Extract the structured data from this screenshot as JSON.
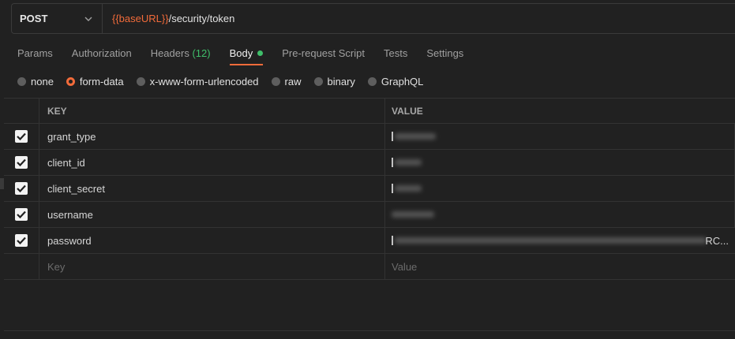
{
  "request": {
    "method": "POST",
    "url_variable": "{{baseURL}}",
    "url_path": "/security/token"
  },
  "tabs": [
    {
      "label": "Params"
    },
    {
      "label": "Authorization"
    },
    {
      "label": "Headers",
      "count": "(12)"
    },
    {
      "label": "Body",
      "active": true
    },
    {
      "label": "Pre-request Script"
    },
    {
      "label": "Tests"
    },
    {
      "label": "Settings"
    }
  ],
  "body_types": [
    {
      "label": "none",
      "selected": false
    },
    {
      "label": "form-data",
      "selected": true
    },
    {
      "label": "x-www-form-urlencoded",
      "selected": false
    },
    {
      "label": "raw",
      "selected": false
    },
    {
      "label": "binary",
      "selected": false
    },
    {
      "label": "GraphQL",
      "selected": false
    }
  ],
  "table": {
    "headers": {
      "key": "KEY",
      "value": "VALUE"
    },
    "rows": [
      {
        "key": "grant_type",
        "checked": true,
        "value_truncated": ""
      },
      {
        "key": "client_id",
        "checked": true,
        "value_truncated": ""
      },
      {
        "key": "client_secret",
        "checked": true,
        "value_truncated": ""
      },
      {
        "key": "username",
        "checked": true,
        "value_truncated": ""
      },
      {
        "key": "password",
        "checked": true,
        "value_truncated": "RC..."
      }
    ],
    "placeholders": {
      "key": "Key",
      "value": "Value"
    }
  },
  "colors": {
    "accent": "#f26b3a",
    "success": "#3fbf6a",
    "background": "#212121"
  }
}
